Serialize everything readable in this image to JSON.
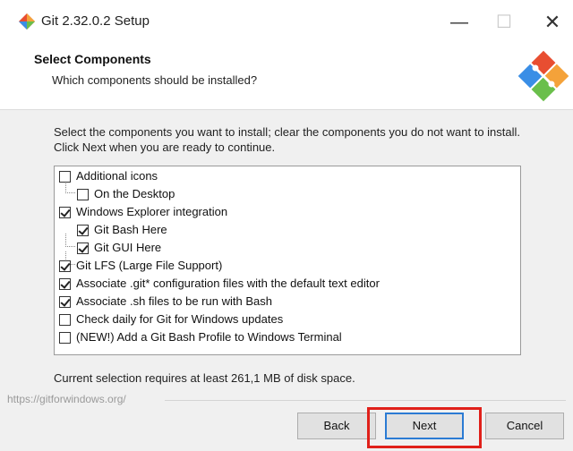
{
  "window": {
    "title": "Git 2.32.0.2 Setup",
    "minimize_glyph": "—",
    "maximize_glyph": "☐",
    "close_glyph": "✕"
  },
  "header": {
    "title": "Select Components",
    "subtitle": "Which components should be installed?"
  },
  "description": "Select the components you want to install; clear the components you do not want to install. Click Next when you are ready to continue.",
  "components": [
    {
      "label": "Additional icons",
      "checked": false,
      "indent": 0
    },
    {
      "label": "On the Desktop",
      "checked": false,
      "indent": 1
    },
    {
      "label": "Windows Explorer integration",
      "checked": true,
      "indent": 0
    },
    {
      "label": "Git Bash Here",
      "checked": true,
      "indent": 1
    },
    {
      "label": "Git GUI Here",
      "checked": true,
      "indent": 1
    },
    {
      "label": "Git LFS (Large File Support)",
      "checked": true,
      "indent": 0
    },
    {
      "label": "Associate .git* configuration files with the default text editor",
      "checked": true,
      "indent": 0
    },
    {
      "label": "Associate .sh files to be run with Bash",
      "checked": true,
      "indent": 0
    },
    {
      "label": "Check daily for Git for Windows updates",
      "checked": false,
      "indent": 0
    },
    {
      "label": "(NEW!) Add a Git Bash Profile to Windows Terminal",
      "checked": false,
      "indent": 0
    }
  ],
  "disk_space": "Current selection requires at least 261,1 MB of disk space.",
  "url": "https://gitforwindows.org/",
  "buttons": {
    "back": "Back",
    "next": "Next",
    "cancel": "Cancel"
  },
  "colors": {
    "highlight": "#e0201a",
    "focus_border": "#2b7bd4"
  }
}
